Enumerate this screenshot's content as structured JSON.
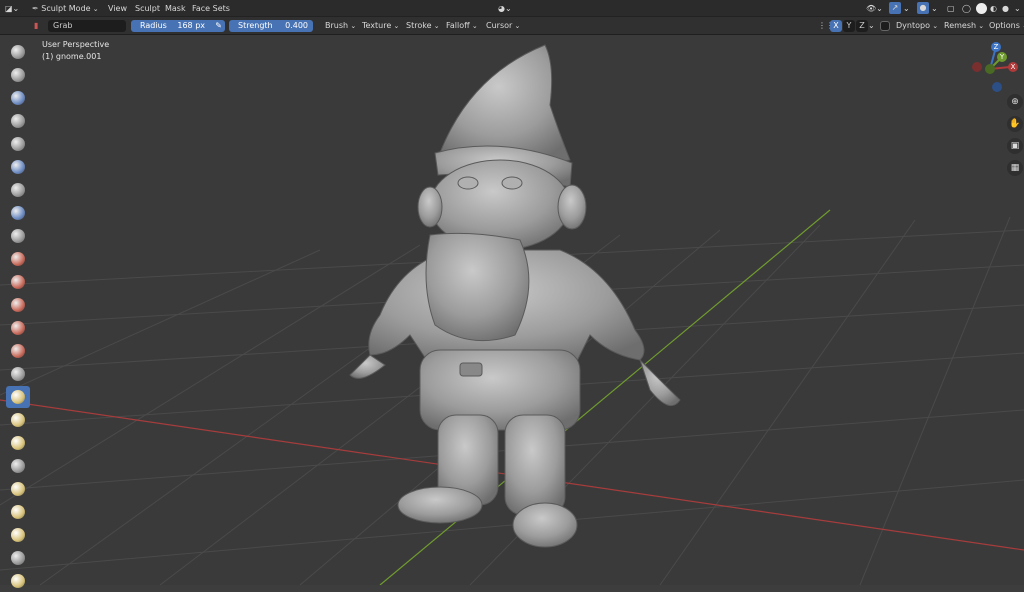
{
  "header": {
    "mode": "Sculpt Mode",
    "menus": [
      "View",
      "Sculpt",
      "Mask",
      "Face Sets"
    ]
  },
  "tool_settings": {
    "brush_name": "Grab",
    "radius_label": "Radius",
    "radius_value": "168 px",
    "strength_label": "Strength",
    "strength_value": "0.400",
    "menus": [
      "Brush",
      "Texture",
      "Stroke",
      "Falloff",
      "Cursor"
    ],
    "axes": [
      "X",
      "Y",
      "Z"
    ],
    "dyntopo_label": "Dyntopo",
    "remesh_label": "Remesh",
    "options_label": "Options"
  },
  "viewport": {
    "view_name": "User Perspective",
    "object_name": "(1) gnome.001",
    "gizmo_axes": [
      "Z",
      "Y",
      "X"
    ]
  },
  "colors": {
    "accent": "#4772b3",
    "x_axis": "#b03a3a",
    "y_axis": "#6f9a2e",
    "z_axis": "#3d74c4"
  }
}
